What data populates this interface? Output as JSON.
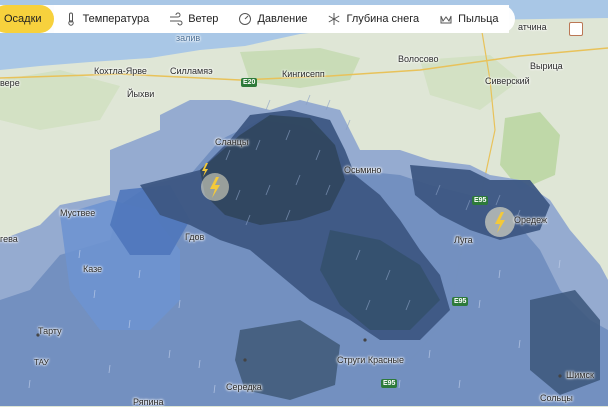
{
  "toolbar": {
    "tabs": [
      {
        "label": "Осадки",
        "icon": "precipitation-icon",
        "active": true
      },
      {
        "label": "Температура",
        "icon": "thermometer-icon",
        "active": false
      },
      {
        "label": "Ветер",
        "icon": "wind-icon",
        "active": false
      },
      {
        "label": "Давление",
        "icon": "pressure-gauge-icon",
        "active": false
      },
      {
        "label": "Глубина снега",
        "icon": "snowflake-icon",
        "active": false
      },
      {
        "label": "Пыльца",
        "icon": "pollen-icon",
        "active": false
      }
    ]
  },
  "map": {
    "water_label": "залив",
    "places": {
      "kohtla": "Кохтла-Ярве",
      "sillamae": "Силламяэ",
      "kingisepp": "Кингисепп",
      "volosovo": "Волосово",
      "atchina": "атчина",
      "vyritsa": "Вырица",
      "siversky": "Сиверский",
      "iyhvi": "Йыхви",
      "slantsy": "Сланцы",
      "osmino": "Осьмино",
      "oredezh": "Оредеж",
      "luga": "Луга",
      "mustvee": "Муствее",
      "gdov": "Гдов",
      "kaze": "Казе",
      "tartu": "Тарту",
      "tay": "ТАУ",
      "strugi": "Струги Красные",
      "seredka": "Середка",
      "shimsk": "Шимск",
      "soltsy": "Сольцы",
      "ryapina": "Ряпина",
      "vere": "вере",
      "egeva": "гева"
    },
    "roads": {
      "e20": "E20",
      "e95a": "E95",
      "e95b": "E95",
      "e95c": "E95"
    },
    "colors": {
      "land": "#dfe6d6",
      "forest": "#c9dcb7",
      "water": "#a9c7e6",
      "precip_light": "#8ea6cf",
      "precip_medium": "#5f7fb5",
      "precip_heavy": "#3d5783",
      "precip_storm": "#30475f",
      "lightning": "#f3c93a"
    }
  }
}
